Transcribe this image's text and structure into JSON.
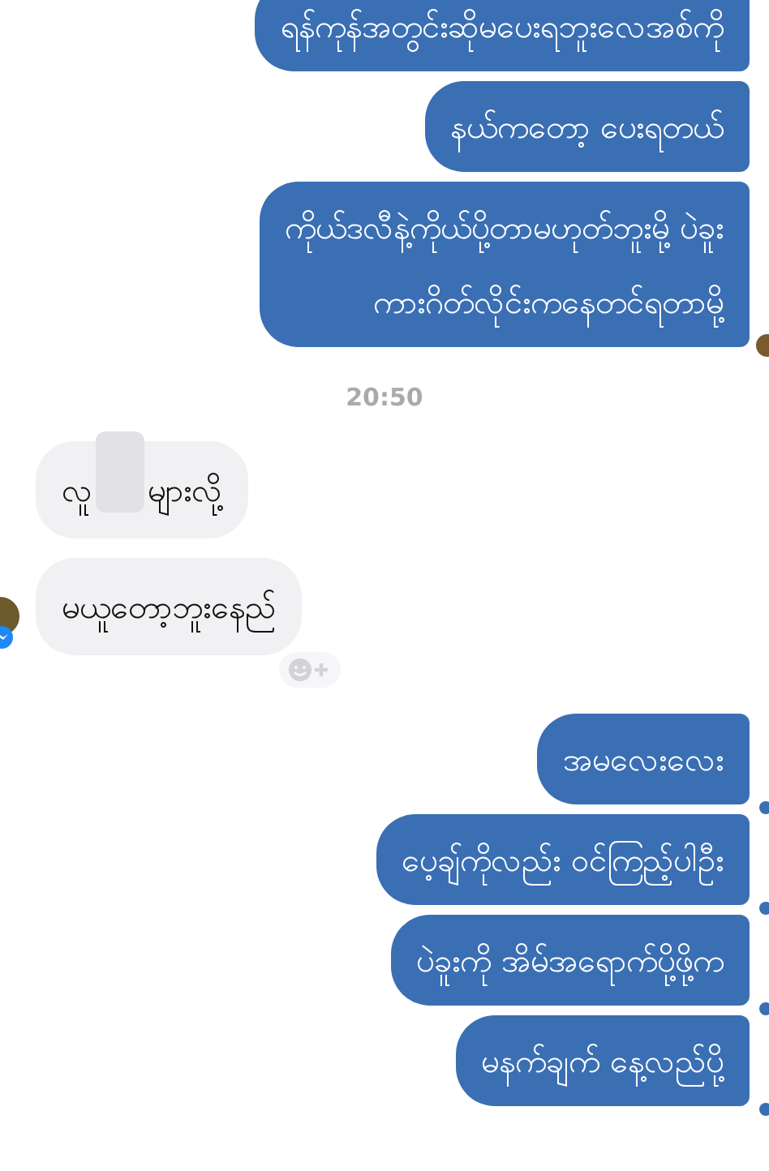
{
  "messages": [
    {
      "kind": "sent",
      "lines": [
        "ရန်ကုန်အတွင်းဆိုမပေးရဘူးလေအစ်ကို"
      ],
      "delivered": false,
      "seen": false
    },
    {
      "kind": "sent",
      "lines": [
        "နယ်ကတော့ ပေးရတယ်"
      ],
      "delivered": false,
      "seen": false
    },
    {
      "kind": "sent",
      "lines": [
        "ကိုယ်ဒလီနဲ့ကိုယ်ပို့တာမဟုတ်ဘူးမို့ ပဲခူး",
        "ကားဂိတ်လိုင်းကနေတင်ရတာမို့"
      ],
      "delivered": false,
      "seen": true
    },
    {
      "kind": "timestamp",
      "text": "20:50"
    },
    {
      "kind": "received",
      "parts": [
        "လူ",
        "များလို့"
      ],
      "redacted": true,
      "avatar": false,
      "reaction_button": false
    },
    {
      "kind": "received",
      "parts": [
        "မယူတော့ဘူးနေည်"
      ],
      "redacted": false,
      "avatar": true,
      "reaction_button": true
    },
    {
      "kind": "sent",
      "lines": [
        "အမလေးလေး"
      ],
      "delivered": true,
      "seen": false
    },
    {
      "kind": "sent",
      "lines": [
        "ပေ့ချ်ကိုလည်း ဝင်ကြည့်ပါဦး"
      ],
      "delivered": true,
      "seen": false
    },
    {
      "kind": "sent",
      "lines": [
        "ပဲခူးကို အိမ်အရောက်ပို့ဖို့က"
      ],
      "delivered": true,
      "seen": false
    },
    {
      "kind": "sent",
      "lines": [
        "မနက်ချက် နေ့လည်ပို့"
      ],
      "delivered": true,
      "seen": false
    }
  ]
}
